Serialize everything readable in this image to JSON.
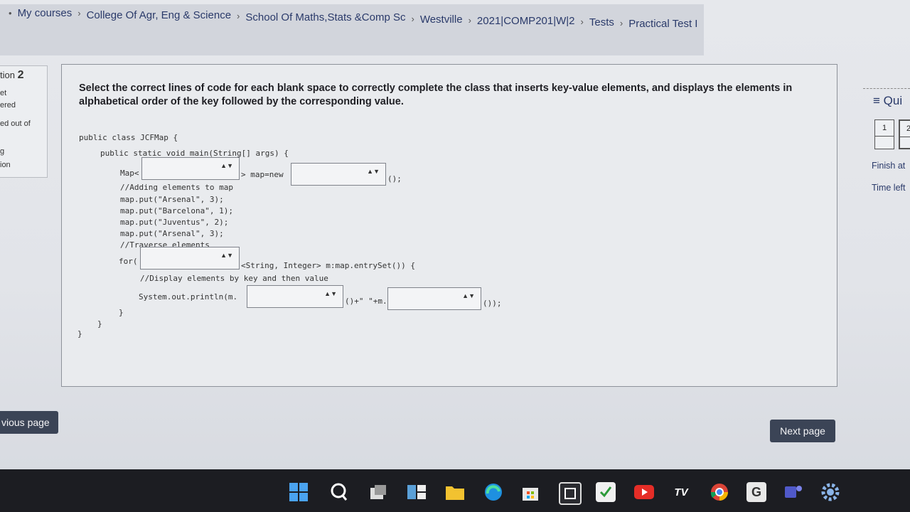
{
  "breadcrumb": [
    "My courses",
    "College Of Agr, Eng & Science",
    "School Of Maths,Stats &Comp Sc",
    "Westville",
    "2021|COMP201|W|2",
    "Tests",
    "Practical Test I"
  ],
  "breadcrumb_separator": "›",
  "question_info": {
    "label_prefix": "tion",
    "number": "2",
    "lines": [
      "et",
      "ered",
      "ed out of",
      "g",
      "ion"
    ]
  },
  "question": {
    "text": "Select the correct lines of code for each blank space to correctly complete the class that inserts key-value elements, and displays the elements in alphabetical order of the key followed by the corresponding value."
  },
  "code": {
    "line1": "public class JCFMap {",
    "line2": "public static void main(String[] args) {",
    "map_prefix": "Map<",
    "map_middle": "> map=new",
    "map_suffix": "();",
    "comment_add": "//Adding elements to map",
    "put1": "map.put(\"Arsenal\", 3);",
    "put2": "map.put(\"Barcelona\", 1);",
    "put3": "map.put(\"Juventus\", 2);",
    "put4": "map.put(\"Arsenal\", 3);",
    "comment_traverse": "//Traverse elements",
    "for_prefix": "for(",
    "for_suffix": "<String, Integer> m:map.entrySet()) {",
    "comment_display": "//Display elements by key and then value",
    "print_prefix": "System.out.println(m.",
    "print_middle": "()+\" \"+m.",
    "print_suffix": "());",
    "close_inner": "}",
    "close_main": "}",
    "close_class": "}"
  },
  "dropdowns": {
    "arrow": "▲▼",
    "map_key_type": "",
    "map_impl": "",
    "entry_type": "",
    "get_key": "",
    "get_value": ""
  },
  "quiz_nav": {
    "heading": "Qui",
    "menu_icon": "≡",
    "question_numbers": [
      "1",
      "2"
    ],
    "finish_link": "Finish at",
    "time_left": "Time left"
  },
  "buttons": {
    "previous": "vious page",
    "next": "Next page"
  },
  "taskbar": {
    "icons": [
      "windows-start-icon",
      "search-icon",
      "task-view-icon",
      "widgets-icon",
      "file-explorer-icon",
      "edge-icon",
      "store-icon",
      "app-icon",
      "vernacular-icon",
      "youtube-icon",
      "tv-icon",
      "chrome-icon",
      "g-icon",
      "teams-icon",
      "settings-icon"
    ]
  }
}
